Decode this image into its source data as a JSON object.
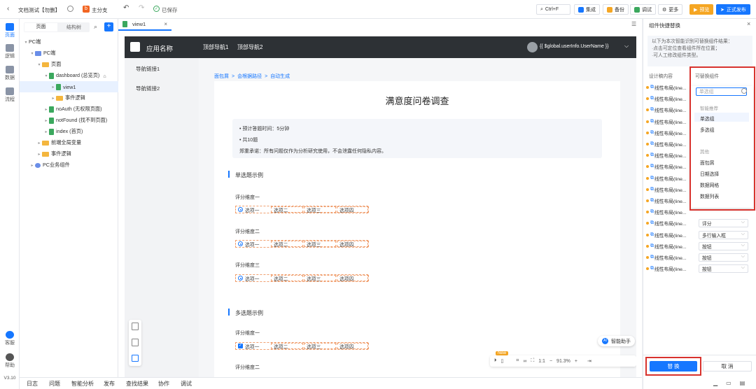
{
  "topbar": {
    "back_icon": "chevron-left-icon",
    "doc_title": "文档测试【勿删】",
    "branch_badge": "b",
    "branch_label": "主分支",
    "saved_label": "已保存",
    "search_shortcut": "Ctrl+F",
    "buttons": {
      "integrate": "集成",
      "backup": "备份",
      "debug": "调试",
      "more": "更多",
      "preview": "预览",
      "publish": "正式发布"
    },
    "colors": {
      "preview": "#f5a623",
      "publish": "#1677ff"
    }
  },
  "rail": {
    "items": [
      "页面",
      "逻辑",
      "数据",
      "流程"
    ],
    "service": "客服",
    "help": "帮助",
    "version": "V3.10"
  },
  "tree": {
    "tabs": [
      "页面",
      "结构树"
    ],
    "nodes": [
      {
        "label": "PC端"
      },
      {
        "label": "PC端"
      },
      {
        "label": "页面"
      },
      {
        "label": "dashboard (总览页)"
      },
      {
        "label": "view1"
      },
      {
        "label": "事件逻辑"
      },
      {
        "label": "noAuth (无权限页面)"
      },
      {
        "label": "notFound (找不到页面)"
      },
      {
        "label": "index (首页)"
      },
      {
        "label": "前端全局变量"
      },
      {
        "label": "事件逻辑"
      },
      {
        "label": "PC业务组件"
      }
    ]
  },
  "bottombar": {
    "tabs": [
      "日志",
      "问题",
      "智能分析",
      "发布",
      "查找结果",
      "协作",
      "调试"
    ]
  },
  "editor": {
    "tab_label": "view1",
    "app_name": "应用名称",
    "top_nav": [
      "顶部导航1",
      "顶部导航2"
    ],
    "user_expr": "{{ $global.userInfo.UserName }}",
    "side_nav": [
      "导航链接1",
      "导航链接2"
    ],
    "breadcrumb": [
      "面包屑",
      "会根据路径",
      "自动生成"
    ],
    "survey_title": "满意度问卷调查",
    "info": [
      "预计答题时间：5分钟",
      "共10题",
      "郑重承诺：所有问题仅作为分析研究使用，不会泄露任何隐私内容。"
    ],
    "section1": "单选题示例",
    "section2": "多选题示例",
    "dims": [
      "评分维度一",
      "评分维度二",
      "评分维度三",
      "评分维度一",
      "评分维度二"
    ],
    "options": [
      "选项一",
      "选项二",
      "选项三",
      "选项四"
    ],
    "new_badge": "New",
    "ai_label": "智能助手",
    "zoom": "91.3%",
    "ratio": "1:1"
  },
  "right": {
    "title": "组件快捷替换",
    "desc": [
      "以下为本次智能识别可替换组件结果：",
      "·点击可定位查看组件所在位置；",
      "·可人工修改组件类型。"
    ],
    "col1": "设计稿内容",
    "col2": "可替换组件",
    "row_label": "线性布局(line...",
    "rows": [
      "",
      "",
      "",
      "",
      "",
      "",
      "",
      "",
      "",
      "",
      "",
      "",
      "评分",
      "多行输入框",
      "按钮",
      "按钮",
      "按钮"
    ],
    "dropdown_value": "单选组",
    "dropdown_groups": [
      {
        "name": "智能推荐",
        "items": [
          "单选组",
          "多选组"
        ]
      },
      {
        "name": "其他",
        "items": [
          "面包屑",
          "日期选择",
          "数据网格",
          "数据列表"
        ]
      }
    ],
    "confirm": "替 换",
    "cancel": "取 消"
  }
}
